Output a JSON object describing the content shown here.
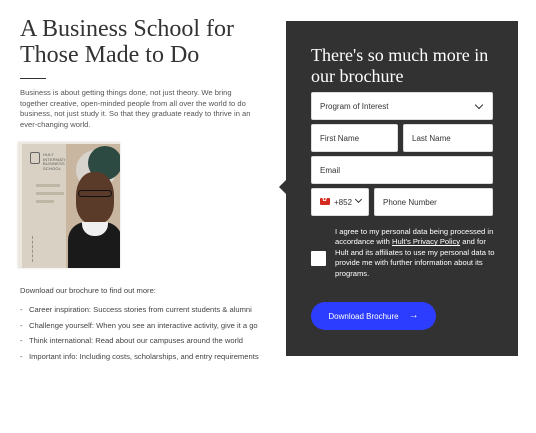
{
  "left": {
    "headline_line1": "A Business School for",
    "headline_line2": "Those Made to Do",
    "intro": "Business is about getting things done, not just theory. We bring together creative, open-minded people from all over the world to do business, not just study it. So that they graduate ready to thrive in an ever-changing world.",
    "brochure_brand": "HULT INTERNATIONAL BUSINESS SCHOOL",
    "download_label": "Download our brochure to find out more:",
    "list": [
      "Career inspiration: Success stories from current students & alumni",
      "Challenge yourself: When you see an interactive activity, give it a go",
      "Think international: Read about our campuses around the world",
      "Important info: Including costs, scholarships, and entry requirements"
    ]
  },
  "form": {
    "title": "There's so much more in our brochure",
    "program_placeholder": "Program of Interest",
    "first_name_placeholder": "First Name",
    "last_name_placeholder": "Last Name",
    "email_placeholder": "Email",
    "country_code": "+852",
    "phone_placeholder": "Phone Number",
    "consent_part1": "I agree to my personal data being processed in accordance with ",
    "consent_link1": "Hult's Privacy Policy",
    "consent_part2": " and for Hult and its affiliates to use my personal data to provide me with further information about its programs.",
    "button_label": "Download Brochure",
    "button_arrow": "→"
  },
  "colors": {
    "panel": "#333232",
    "button": "#2d3dff",
    "flag": "#d52b1e"
  },
  "icons": {
    "program_dropdown": "chevron-down-icon",
    "country_dropdown": "chevron-down-icon",
    "flag": "hong-kong-flag-icon",
    "button": "arrow-right-icon"
  }
}
